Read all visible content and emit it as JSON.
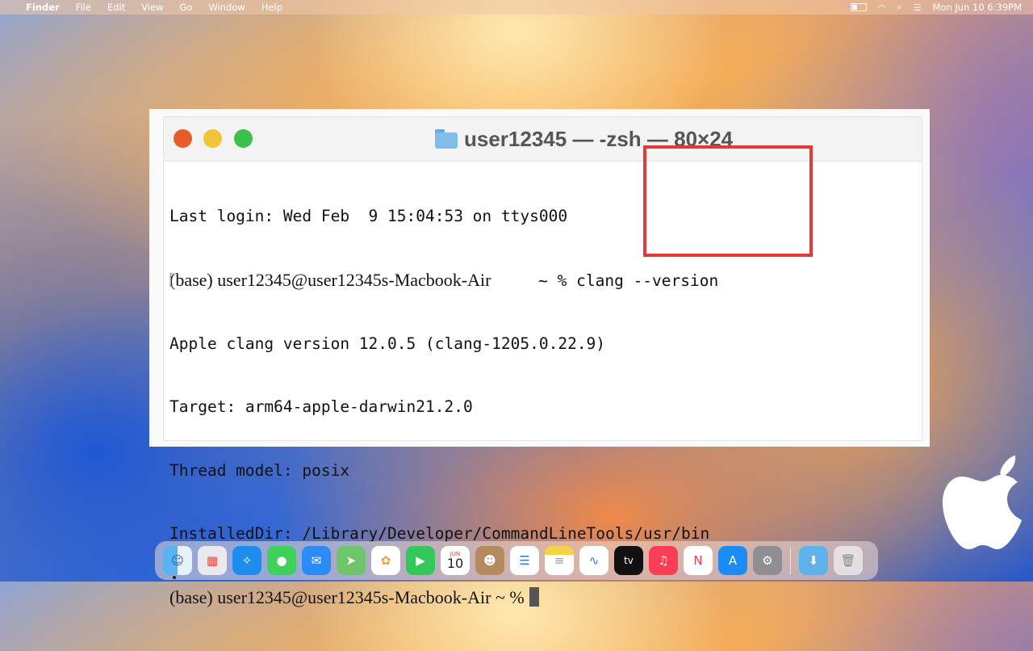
{
  "menubar": {
    "app": "Finder",
    "items": [
      "File",
      "Edit",
      "View",
      "Go",
      "Window",
      "Help"
    ],
    "datetime": "Mon Jun 10  6:39PM"
  },
  "terminal": {
    "title": "user12345 — -zsh — 80×24",
    "lines": [
      "Last login: Wed Feb  9 15:04:53 on ttys000",
      "Apple clang version 12.0.5 (clang-1205.0.22.9)",
      "Target: arm64-apple-darwin21.2.0",
      "Thread model: posix",
      "InstalledDir: /Library/Developer/CommandLineTools/usr/bin"
    ],
    "prompt1": "(base) user12345@user12345s-Macbook-Air",
    "prompt1_suffix": "     ~ % ",
    "command": "clang --version",
    "prompt2": "(base) user12345@user12345s-Macbook-Air ~ %"
  },
  "dock": {
    "calendar_month": "JUN",
    "calendar_day": "10",
    "tv_label": "tv"
  },
  "colors": {
    "highlight": "#e4393b"
  }
}
